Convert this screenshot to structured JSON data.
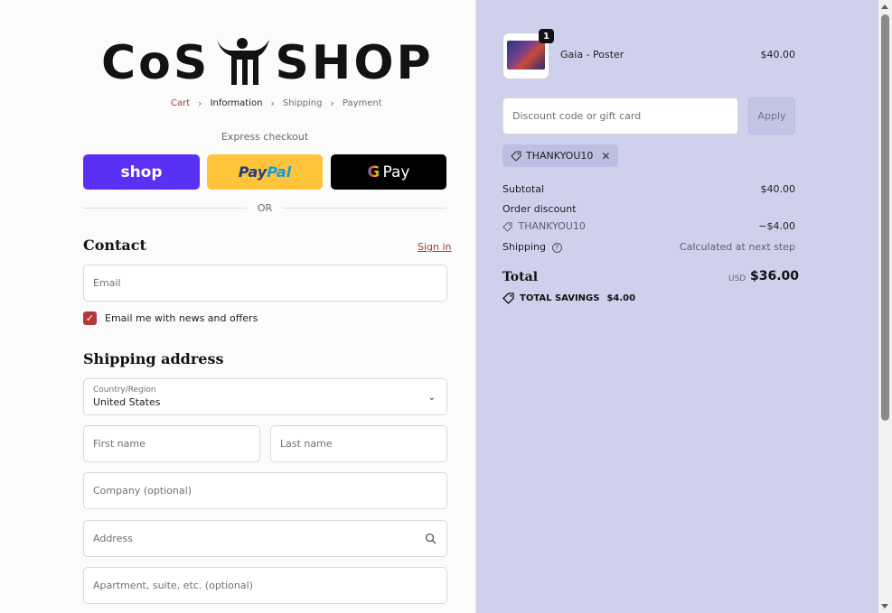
{
  "brand": {
    "logo_text_left": "CoS",
    "logo_text_right": "SHOP"
  },
  "breadcrumb": [
    {
      "label": "Cart",
      "state": "link"
    },
    {
      "label": "Information",
      "state": "active"
    },
    {
      "label": "Shipping",
      "state": "upcoming"
    },
    {
      "label": "Payment",
      "state": "upcoming"
    }
  ],
  "express": {
    "label": "Express checkout",
    "shop_label": "shop",
    "paypal_part1": "Pay",
    "paypal_part2": "Pal",
    "gpay_g": "G",
    "gpay_label": "Pay",
    "divider": "OR"
  },
  "contact": {
    "title": "Contact",
    "signin_label": "Sign in",
    "email_placeholder": "Email",
    "newsletter_label": "Email me with news and offers",
    "newsletter_checked": true
  },
  "shipping": {
    "title": "Shipping address",
    "country_label": "Country/Region",
    "country_value": "United States",
    "first_name_placeholder": "First name",
    "last_name_placeholder": "Last name",
    "company_placeholder": "Company (optional)",
    "address_placeholder": "Address",
    "apartment_placeholder": "Apartment, suite, etc. (optional)"
  },
  "order": {
    "item": {
      "name": "Gaia - Poster",
      "price": "$40.00",
      "quantity": "1"
    },
    "discount_placeholder": "Discount code or gift card",
    "apply_label": "Apply",
    "applied_code": "THANKYOU10",
    "subtotal_label": "Subtotal",
    "subtotal_value": "$40.00",
    "order_discount_label": "Order discount",
    "discount_code": "THANKYOU10",
    "discount_value": "−$4.00",
    "shipping_label": "Shipping",
    "shipping_value": "Calculated at next step",
    "total_label": "Total",
    "total_currency": "USD",
    "total_value": "$36.00",
    "savings_label": "TOTAL SAVINGS",
    "savings_value": "$4.00"
  },
  "colors": {
    "accent": "#b5393a",
    "shop_pay": "#5a31f4",
    "paypal": "#ffc439",
    "sidebar_bg": "#cfd0ec"
  }
}
